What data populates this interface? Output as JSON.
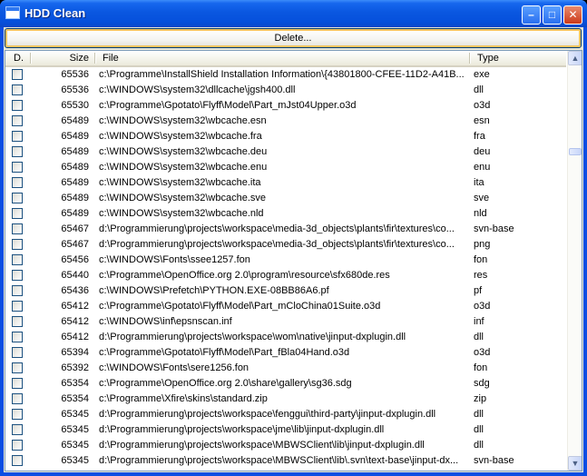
{
  "window": {
    "title": "HDD Clean",
    "minimize": "–",
    "maximize": "□",
    "close": "✕"
  },
  "toolbar": {
    "delete_label": "Delete..."
  },
  "columns": {
    "d": "D.",
    "size": "Size",
    "file": "File",
    "type": "Type"
  },
  "scroll": {
    "up": "▲",
    "down": "▼"
  },
  "rows": [
    {
      "size": "65536",
      "file": "c:\\Programme\\InstallShield Installation Information\\{43801800-CFEE-11D2-A41B...",
      "type": "exe"
    },
    {
      "size": "65536",
      "file": "c:\\WINDOWS\\system32\\dllcache\\jgsh400.dll",
      "type": "dll"
    },
    {
      "size": "65530",
      "file": "c:\\Programme\\Gpotato\\Flyff\\Model\\Part_mJst04Upper.o3d",
      "type": "o3d"
    },
    {
      "size": "65489",
      "file": "c:\\WINDOWS\\system32\\wbcache.esn",
      "type": "esn"
    },
    {
      "size": "65489",
      "file": "c:\\WINDOWS\\system32\\wbcache.fra",
      "type": "fra"
    },
    {
      "size": "65489",
      "file": "c:\\WINDOWS\\system32\\wbcache.deu",
      "type": "deu"
    },
    {
      "size": "65489",
      "file": "c:\\WINDOWS\\system32\\wbcache.enu",
      "type": "enu"
    },
    {
      "size": "65489",
      "file": "c:\\WINDOWS\\system32\\wbcache.ita",
      "type": "ita"
    },
    {
      "size": "65489",
      "file": "c:\\WINDOWS\\system32\\wbcache.sve",
      "type": "sve"
    },
    {
      "size": "65489",
      "file": "c:\\WINDOWS\\system32\\wbcache.nld",
      "type": "nld"
    },
    {
      "size": "65467",
      "file": "d:\\Programmierung\\projects\\workspace\\media-3d_objects\\plants\\fir\\textures\\co...",
      "type": "svn-base"
    },
    {
      "size": "65467",
      "file": "d:\\Programmierung\\projects\\workspace\\media-3d_objects\\plants\\fir\\textures\\co...",
      "type": "png"
    },
    {
      "size": "65456",
      "file": "c:\\WINDOWS\\Fonts\\ssee1257.fon",
      "type": "fon"
    },
    {
      "size": "65440",
      "file": "c:\\Programme\\OpenOffice.org 2.0\\program\\resource\\sfx680de.res",
      "type": "res"
    },
    {
      "size": "65436",
      "file": "c:\\WINDOWS\\Prefetch\\PYTHON.EXE-08BB86A6.pf",
      "type": "pf"
    },
    {
      "size": "65412",
      "file": "c:\\Programme\\Gpotato\\Flyff\\Model\\Part_mCloChina01Suite.o3d",
      "type": "o3d"
    },
    {
      "size": "65412",
      "file": "c:\\WINDOWS\\inf\\epsnscan.inf",
      "type": "inf"
    },
    {
      "size": "65412",
      "file": "d:\\Programmierung\\projects\\workspace\\wom\\native\\jinput-dxplugin.dll",
      "type": "dll"
    },
    {
      "size": "65394",
      "file": "c:\\Programme\\Gpotato\\Flyff\\Model\\Part_fBla04Hand.o3d",
      "type": "o3d"
    },
    {
      "size": "65392",
      "file": "c:\\WINDOWS\\Fonts\\sere1256.fon",
      "type": "fon"
    },
    {
      "size": "65354",
      "file": "c:\\Programme\\OpenOffice.org 2.0\\share\\gallery\\sg36.sdg",
      "type": "sdg"
    },
    {
      "size": "65354",
      "file": "c:\\Programme\\Xfire\\skins\\standard.zip",
      "type": "zip"
    },
    {
      "size": "65345",
      "file": "d:\\Programmierung\\projects\\workspace\\fenggui\\third-party\\jinput-dxplugin.dll",
      "type": "dll"
    },
    {
      "size": "65345",
      "file": "d:\\Programmierung\\projects\\workspace\\jme\\lib\\jinput-dxplugin.dll",
      "type": "dll"
    },
    {
      "size": "65345",
      "file": "d:\\Programmierung\\projects\\workspace\\MBWSClient\\lib\\jinput-dxplugin.dll",
      "type": "dll"
    },
    {
      "size": "65345",
      "file": "d:\\Programmierung\\projects\\workspace\\MBWSClient\\lib\\.svn\\text-base\\jinput-dx...",
      "type": "svn-base"
    }
  ]
}
